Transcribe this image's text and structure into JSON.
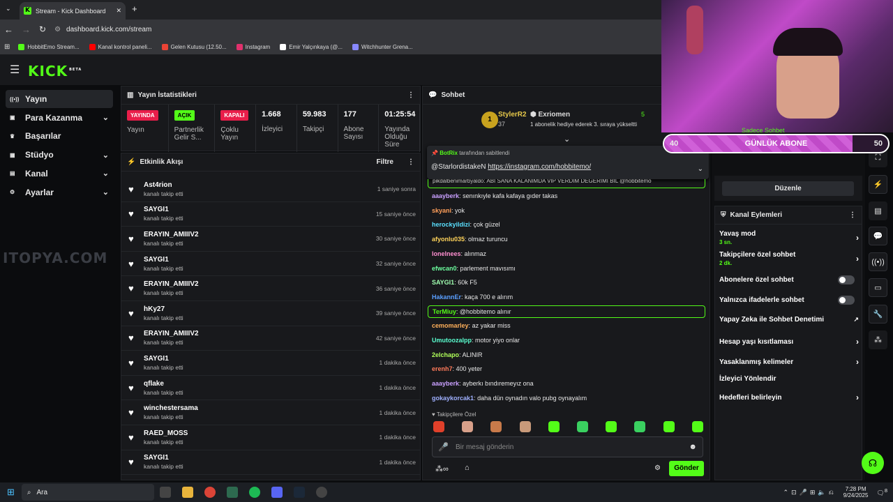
{
  "browser": {
    "tab_title": "Stream - Kick Dashboard",
    "url": "dashboard.kick.com/stream",
    "bookmarks": [
      {
        "label": "HobbitEmo Stream...",
        "color": "#53fc18"
      },
      {
        "label": "Kanal kontrol paneli...",
        "color": "#ff0000"
      },
      {
        "label": "Gelen Kutusu (12.50...",
        "color": "#ea4335"
      },
      {
        "label": "Instagram",
        "color": "#e1306c"
      },
      {
        "label": "Emir Yalçınkaya (@...",
        "color": "#ffffff"
      },
      {
        "label": "Witchhunter Grena...",
        "color": "#8888ff"
      }
    ]
  },
  "kick": {
    "logo": "KICK",
    "beta": "BETA"
  },
  "sidebar": {
    "items": [
      {
        "label": "Yayın",
        "icon": "broadcast-icon",
        "active": true,
        "chevron": false
      },
      {
        "label": "Para Kazanma",
        "icon": "money-icon",
        "chevron": true
      },
      {
        "label": "Başarılar",
        "icon": "trophy-icon",
        "chevron": false
      },
      {
        "label": "Stüdyo",
        "icon": "studio-icon",
        "chevron": true
      },
      {
        "label": "Kanal",
        "icon": "channel-icon",
        "chevron": true
      },
      {
        "label": "Ayarlar",
        "icon": "gear-icon",
        "chevron": true
      }
    ]
  },
  "watermark": "ITOPYA.COM",
  "stats": {
    "title": "Yayın İstatistikleri",
    "cols": [
      {
        "pill": "YAYINDA",
        "pill_color": "#e91e4a",
        "label": "Yayın"
      },
      {
        "pill": "AÇIK",
        "pill_color": "#53fc18",
        "label": "Partnerlik Gelir S..."
      },
      {
        "pill": "KAPALI",
        "pill_color": "#e91e4a",
        "label": "Çoklu Yayın"
      },
      {
        "value": "1.668",
        "label": "İzleyici"
      },
      {
        "value": "59.983",
        "label": "Takipçi"
      },
      {
        "value": "177",
        "label": "Abone Sayısı"
      },
      {
        "value": "01:25:54",
        "label": "Yayında Olduğu Süre"
      }
    ]
  },
  "activity": {
    "title": "Etkinlik Akışı",
    "filter": "Filtre",
    "events": [
      {
        "user": "Ast4rion",
        "action": "kanalı takip etti",
        "time": "1 saniye sonra"
      },
      {
        "user": "SAYGI1",
        "action": "kanalı takip etti",
        "time": "15 saniye önce"
      },
      {
        "user": "ERAYIN_AMIIIV2",
        "action": "kanalı takip etti",
        "time": "30 saniye önce"
      },
      {
        "user": "SAYGI1",
        "action": "kanalı takip etti",
        "time": "32 saniye önce"
      },
      {
        "user": "ERAYIN_AMIIIV2",
        "action": "kanalı takip etti",
        "time": "36 saniye önce"
      },
      {
        "user": "hKy27",
        "action": "kanalı takip etti",
        "time": "39 saniye önce"
      },
      {
        "user": "ERAYIN_AMIIIV2",
        "action": "kanalı takip etti",
        "time": "42 saniye önce"
      },
      {
        "user": "SAYGI1",
        "action": "kanalı takip etti",
        "time": "1 dakika önce"
      },
      {
        "user": "qflake",
        "action": "kanalı takip etti",
        "time": "1 dakika önce"
      },
      {
        "user": "winchestersama",
        "action": "kanalı takip etti",
        "time": "1 dakika önce"
      },
      {
        "user": "RAED_MOSS",
        "action": "kanalı takip etti",
        "time": "1 dakika önce"
      },
      {
        "user": "SAYGI1",
        "action": "kanalı takip etti",
        "time": "1 dakika önce"
      }
    ]
  },
  "chat": {
    "title": "Sohbet",
    "top_gifter": {
      "rank": "1",
      "name": "StylerR2",
      "count": "37"
    },
    "gift_banner": {
      "name": "Exriomen",
      "count": "5",
      "text": "1 abonelik hediye ederek 3. sıraya yükseltti"
    },
    "pinned": {
      "by": "BotRix",
      "by_suffix": "tarafından sabitlendi",
      "mention": "@StarlordistakeN",
      "link": "https://instagram.com/hobbitemo/"
    },
    "partial_msg": "pikdalbenimarbyaldo: ABI SANA KALANIMDA VIP VERDIM DEGERIMI BIL @hobbitemo",
    "messages": [
      {
        "user": "aaayberk",
        "color": "#c9a0ff",
        "text": "senınkıyle kafa kafaya gıder takas"
      },
      {
        "user": "skyani",
        "color": "#ff9f5a",
        "text": "yok"
      },
      {
        "user": "herockyildizi",
        "color": "#5ae0ff",
        "text": "çok güzel"
      },
      {
        "user": "afyonlu035",
        "color": "#ffd35a",
        "text": "olmaz turuncu"
      },
      {
        "user": "lonelnees",
        "color": "#ff8fd0",
        "text": "alınmaz"
      },
      {
        "user": "efwcan0",
        "color": "#6dff9f",
        "text": "parlement mavısımı"
      },
      {
        "user": "SAYGI1",
        "color": "#a0ffb0",
        "text": "60k F5"
      },
      {
        "user": "HakannEr",
        "color": "#5a9fff",
        "text": "kaça 700 e alırım"
      },
      {
        "user": "TerMiuy",
        "color": "#53fc18",
        "text": "@hobbitemo alınır",
        "highlight": true
      },
      {
        "user": "cemomarley",
        "color": "#ffb05a",
        "text": "az yakar miss"
      },
      {
        "user": "Umutoozalpp",
        "color": "#5affd0",
        "text": "motor yiyo onlar"
      },
      {
        "user": "2elchapo",
        "color": "#b0ff5a",
        "text": "ALINIR"
      },
      {
        "user": "erenh7",
        "color": "#ff7a5a",
        "text": "400 yeter"
      },
      {
        "user": "aaayberk",
        "color": "#c9a0ff",
        "text": "ayberkı bındıremeyız ona"
      },
      {
        "user": "gokaykorcak1",
        "color": "#9fb0ff",
        "text": "daha dün oynadın valo pubg oynayalım"
      }
    ],
    "followers_only": "Takipçilere Özel",
    "placeholder": "Bir mesaj gönderin",
    "infinity": "∞",
    "send": "Gönder"
  },
  "overlay": {
    "goal_label": "GÜNLÜK ABONE",
    "goal_current": "40",
    "goal_target": "50",
    "goal_fraction": 0.84,
    "behind_text": "Sadece Sohbet"
  },
  "right": {
    "edit_button": "Düzenle",
    "actions_title": "Kanal Eylemleri",
    "actions": [
      {
        "label": "Yavaş mod",
        "sub": "3 sn.",
        "control": "chevron"
      },
      {
        "label": "Takipçilere özel sohbet",
        "sub": "2 dk.",
        "control": "chevron"
      },
      {
        "label": "Abonelere özel sohbet",
        "control": "toggle"
      },
      {
        "label": "Yalnızca ifadelerle sohbet",
        "control": "toggle"
      },
      {
        "label": "Yapay Zeka ile Sohbet Denetimi",
        "control": "external"
      },
      {
        "label": "Hesap yaşı kısıtlaması",
        "control": "chevron"
      },
      {
        "label": "Yasaklanmış kelimeler",
        "control": "chevron"
      },
      {
        "label": "İzleyici Yönlendir",
        "control": "none"
      },
      {
        "label": "Hedefleri belirleyin",
        "control": "chevron"
      }
    ]
  },
  "taskbar": {
    "search": "Ara",
    "time": "7:28 PM",
    "date": "9/24/2025",
    "notif": "8"
  }
}
